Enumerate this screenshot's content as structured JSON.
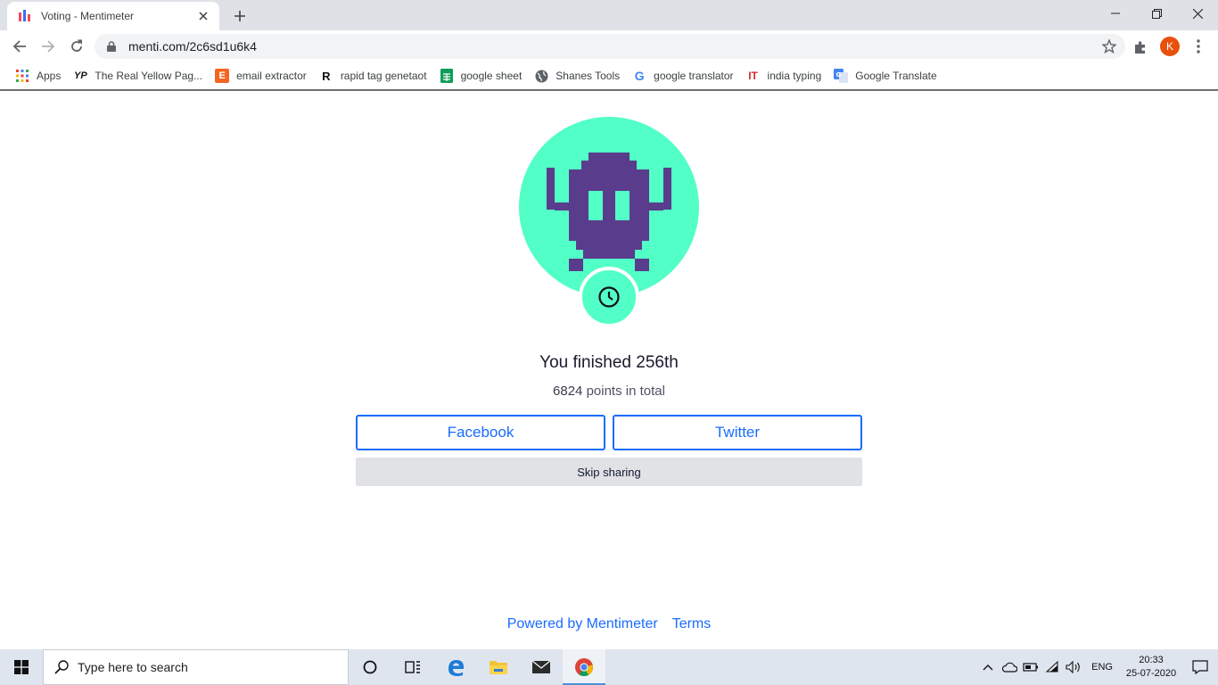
{
  "browser": {
    "tab_title": "Voting - Mentimeter",
    "url": "menti.com/2c6sd1u6k4",
    "profile_initial": "K",
    "bookmarks": [
      {
        "label": "Apps",
        "icon": "apps-grid-icon"
      },
      {
        "label": "The Real Yellow Pag...",
        "icon": "yp-icon",
        "icon_text": "YP"
      },
      {
        "label": "email extractor",
        "icon": "email-extractor-icon",
        "icon_text": "E"
      },
      {
        "label": "rapid tag genetaot",
        "icon": "rapid-tag-icon",
        "icon_text": "R"
      },
      {
        "label": "google sheet",
        "icon": "google-sheets-icon"
      },
      {
        "label": "Shanes Tools",
        "icon": "globe-icon"
      },
      {
        "label": "google translator",
        "icon": "google-g-icon",
        "icon_text": "G"
      },
      {
        "label": "india typing",
        "icon": "india-typing-icon",
        "icon_text": "IT"
      },
      {
        "label": "Google Translate",
        "icon": "google-translate-icon"
      }
    ]
  },
  "result": {
    "finished_text": "You finished 256th",
    "points_value": "6824",
    "points_suffix": " points in total"
  },
  "share": {
    "facebook_label": "Facebook",
    "twitter_label": "Twitter",
    "skip_label": "Skip sharing"
  },
  "footer": {
    "powered_label": "Powered by Mentimeter",
    "terms_label": "Terms"
  },
  "taskbar": {
    "search_placeholder": "Type here to search",
    "language": "ENG",
    "time": "20:33",
    "date": "25-07-2020"
  },
  "colors": {
    "avatar_bg": "#52ffc6",
    "avatar_figure": "#5a3c8c",
    "link_blue": "#196cff",
    "skip_bg": "#e1e2e5"
  }
}
